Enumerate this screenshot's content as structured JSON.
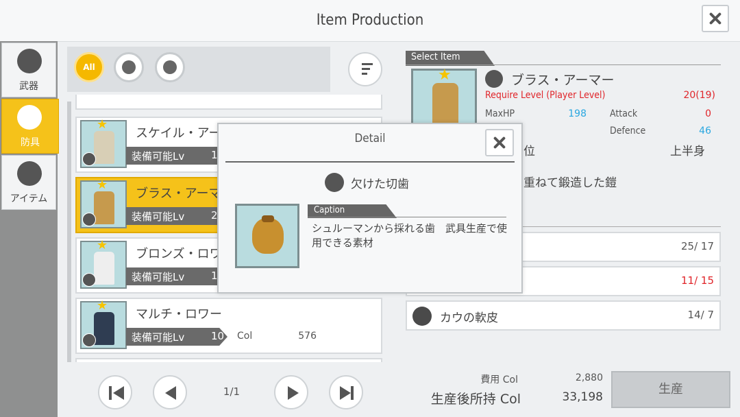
{
  "header": {
    "title": "Item Production"
  },
  "sidebar": {
    "categories": [
      {
        "label": "武器",
        "icon": "sword-icon"
      },
      {
        "label": "防具",
        "icon": "armor-icon"
      },
      {
        "label": "アイテム",
        "icon": "potion-icon"
      }
    ],
    "active": "防具"
  },
  "filters": {
    "all_label": "All"
  },
  "list": {
    "items": [
      {
        "name": "スケイル・アーマー",
        "level_label": "装備可能Lv",
        "level": "15"
      },
      {
        "name": "ブラス・アーマー",
        "level_label": "装備可能Lv",
        "level": "20"
      },
      {
        "name": "ブロンズ・ロワー",
        "level_label": "装備可能Lv",
        "level": "1"
      },
      {
        "name": "マルチ・ロワー",
        "level_label": "装備可能Lv",
        "level": "10",
        "currency": "Col",
        "price": "576"
      }
    ]
  },
  "pager": {
    "page": "1/1"
  },
  "selected": {
    "header": "Select Item",
    "name": "ブラス・アーマー",
    "require_label": "Require Level (Player Level)",
    "require_value": "20(19)",
    "maxhp_label": "MaxHP",
    "maxhp_value": "198",
    "attack_label": "Attack",
    "attack_value": "0",
    "defence_label": "Defence",
    "defence_value": "46",
    "slot_label_partial": "位",
    "slot_value": "上半身",
    "desc_partial": "重ねて鍛造した鎧"
  },
  "materials": [
    {
      "name": "",
      "count": "25/ 17",
      "warn": false
    },
    {
      "name": "",
      "count": "11/ 15",
      "warn": true
    },
    {
      "name": "カウの軟皮",
      "count": "14/ 7",
      "warn": false
    }
  ],
  "cost": {
    "cost_label": "費用 Col",
    "cost_value": "2,880",
    "after_label": "生産後所持 Col",
    "after_value": "33,198",
    "produce_button": "生産"
  },
  "popup": {
    "title": "Detail",
    "item_name": "欠けた切歯",
    "caption_header": "Caption",
    "caption_text": "シュルーマンから採れる歯　武具生産で使用できる素材"
  },
  "colors": {
    "accent": "#f5c21a",
    "hp": "#2aa7e0",
    "warn": "#e0252a",
    "defence": "#2aa7e0"
  }
}
